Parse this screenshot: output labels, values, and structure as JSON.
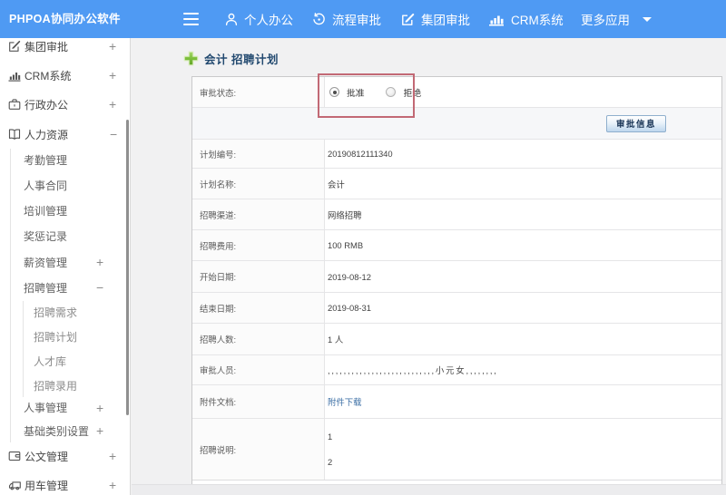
{
  "navbar": {
    "brand": "PHPOA协同办公软件",
    "items": [
      {
        "label": "个人办公",
        "icon": "user-icon"
      },
      {
        "label": "流程审批",
        "icon": "process-arrow-icon"
      },
      {
        "label": "集团审批",
        "icon": "edit-square-icon"
      },
      {
        "label": "CRM系统",
        "icon": "bar-chart-icon"
      },
      {
        "label": "更多应用",
        "icon": "caret-down-icon"
      }
    ]
  },
  "sidebar": {
    "items": [
      {
        "label": "集团审批",
        "level": 1,
        "icon": "edit-square-icon",
        "expander": "+"
      },
      {
        "label": "CRM系统",
        "level": 1,
        "icon": "bar-chart-icon",
        "expander": "+"
      },
      {
        "label": "行政办公",
        "level": 1,
        "icon": "briefcase-icon",
        "expander": "+"
      },
      {
        "label": "人力资源",
        "level": 1,
        "icon": "book-icon",
        "expander": "−"
      },
      {
        "label": "考勤管理",
        "level": 2,
        "expander": ""
      },
      {
        "label": "人事合同",
        "level": 2,
        "expander": ""
      },
      {
        "label": "培训管理",
        "level": 2,
        "expander": ""
      },
      {
        "label": "奖惩记录",
        "level": 2,
        "expander": ""
      },
      {
        "label": "薪资管理",
        "level": 2,
        "expander": "+"
      },
      {
        "label": "招聘管理",
        "level": 2,
        "expander": "−"
      },
      {
        "label": "招聘需求",
        "level": 3,
        "expander": ""
      },
      {
        "label": "招聘计划",
        "level": 3,
        "expander": ""
      },
      {
        "label": "人才库",
        "level": 3,
        "expander": ""
      },
      {
        "label": "招聘录用",
        "level": 3,
        "expander": ""
      },
      {
        "label": "人事管理",
        "level": 2,
        "expander": "+"
      },
      {
        "label": "基础类别设置",
        "level": 2,
        "expander": "+"
      },
      {
        "label": "公文管理",
        "level": 1,
        "icon": "folder-icon",
        "expander": "+"
      },
      {
        "label": "用车管理",
        "level": 1,
        "icon": "truck-icon",
        "expander": "+"
      }
    ]
  },
  "main": {
    "title": "会计 招聘计划",
    "form": {
      "status_label": "审批状态:",
      "radio_approve_label": "批准",
      "radio_reject_label": "拒绝",
      "radio_selected": "批准",
      "approval_info_button": "审批信息",
      "rows": [
        {
          "label": "计划编号:",
          "value": "20190812111340"
        },
        {
          "label": "计划名称:",
          "value": "会计"
        },
        {
          "label": "招聘渠道:",
          "value": "网络招聘"
        },
        {
          "label": "招聘费用:",
          "value": "100 RMB"
        },
        {
          "label": "开始日期:",
          "value": "2019-08-12"
        },
        {
          "label": "结束日期:",
          "value": "2019-08-31"
        },
        {
          "label": "招聘人数:",
          "value": "1 人"
        },
        {
          "label": "审批人员:",
          "value": ",,,,,,,,,,,,,,,,,,,,,,,,,,,小元女,,,,,,,,"
        },
        {
          "label": "附件文档:",
          "value": "附件下载"
        },
        {
          "label": "招聘说明:",
          "value_line1": "1",
          "value_line2": "2"
        }
      ]
    }
  },
  "colors": {
    "navbar_blue": "#4f9af3",
    "content_grey": "#f1f1f2",
    "annotation_red": "#c26975",
    "link_blue": "#3c6fa5",
    "title_navy": "#234a70",
    "plus_icon_green": "#72b832"
  }
}
